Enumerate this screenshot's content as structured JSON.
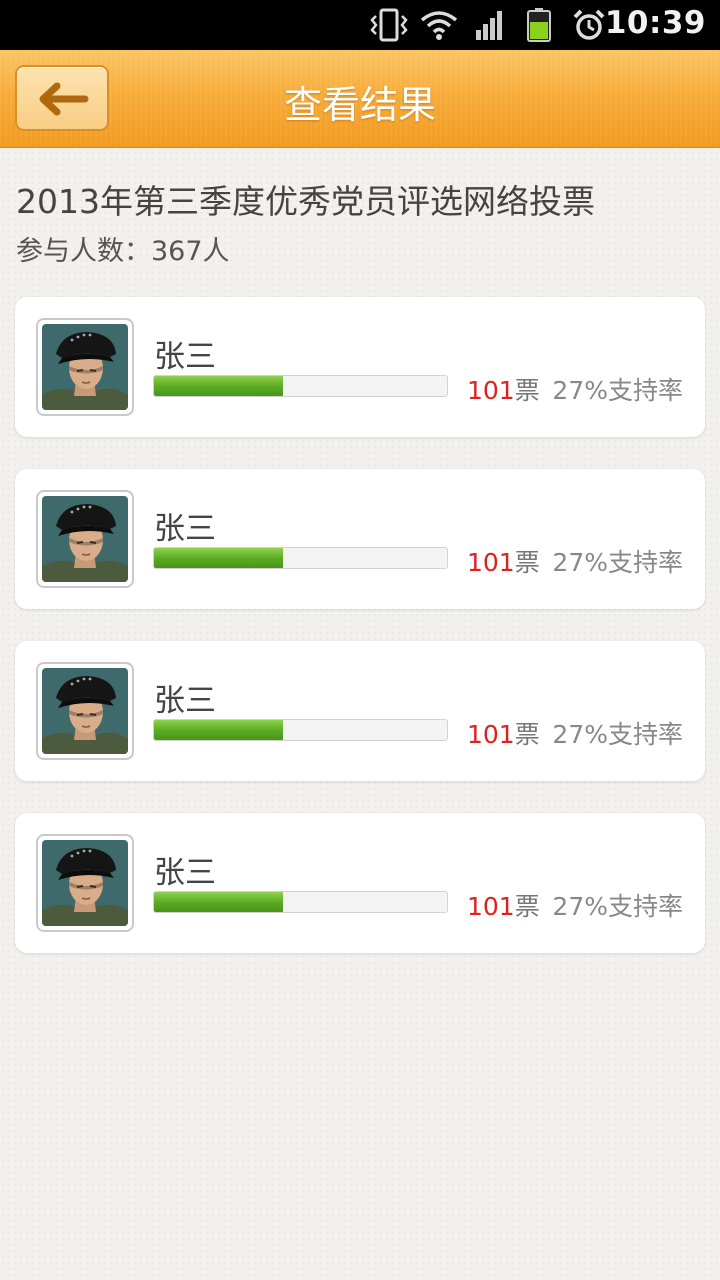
{
  "status_bar": {
    "time": "10:39",
    "icons": [
      "vibrate-icon",
      "wifi-icon",
      "signal-icon",
      "battery-icon",
      "alarm-icon"
    ]
  },
  "header": {
    "title": "查看结果",
    "back_icon": "arrow-left-icon"
  },
  "poll": {
    "title": "2013年第三季度优秀党员评选网络投票",
    "participants": "参与人数：367人"
  },
  "colors": {
    "header": "#f7ac39",
    "progress": "#5aa923",
    "vote_count": "#e02020"
  },
  "candidates": [
    {
      "name": "张三",
      "votes": "101",
      "votes_unit": "票",
      "support": "27%支持率",
      "progress": 0.44
    },
    {
      "name": "张三",
      "votes": "101",
      "votes_unit": "票",
      "support": "27%支持率",
      "progress": 0.44
    },
    {
      "name": "张三",
      "votes": "101",
      "votes_unit": "票",
      "support": "27%支持率",
      "progress": 0.44
    },
    {
      "name": "张三",
      "votes": "101",
      "votes_unit": "票",
      "support": "27%支持率",
      "progress": 0.44
    }
  ]
}
